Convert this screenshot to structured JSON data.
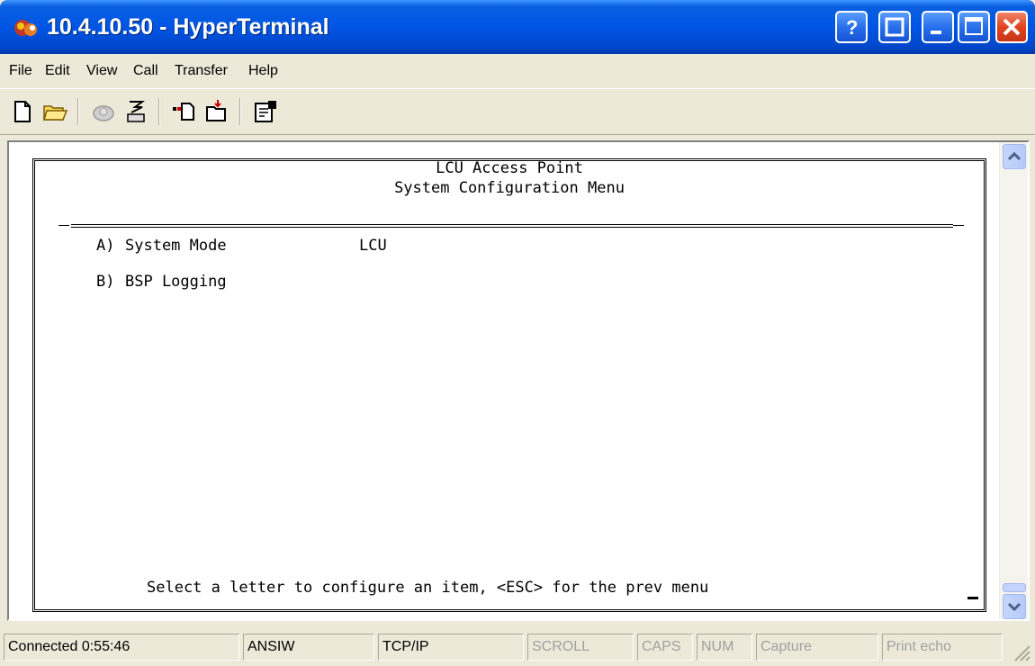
{
  "window": {
    "title": "10.4.10.50 - HyperTerminal",
    "accent": "#0055e5"
  },
  "menu": {
    "items": [
      "File",
      "Edit",
      "View",
      "Call",
      "Transfer",
      "Help"
    ]
  },
  "toolbar": {
    "icons": [
      "new-connection-icon",
      "open-icon",
      "disconnect-icon",
      "dial-icon",
      "send-icon",
      "receive-icon",
      "properties-icon"
    ]
  },
  "terminal": {
    "heading1": "LCU Access Point",
    "heading2": "System Configuration Menu",
    "options": [
      {
        "key": "A)",
        "label": "System Mode",
        "value": "LCU"
      },
      {
        "key": "B)",
        "label": "BSP Logging",
        "value": ""
      }
    ],
    "prompt": "Select a letter to configure an item, <ESC> for the prev menu"
  },
  "status": {
    "connected": "Connected 0:55:46",
    "emulation": "ANSIW",
    "protocol": "TCP/IP",
    "scroll": "SCROLL",
    "caps": "CAPS",
    "num": "NUM",
    "capture": "Capture",
    "print_echo": "Print echo"
  }
}
